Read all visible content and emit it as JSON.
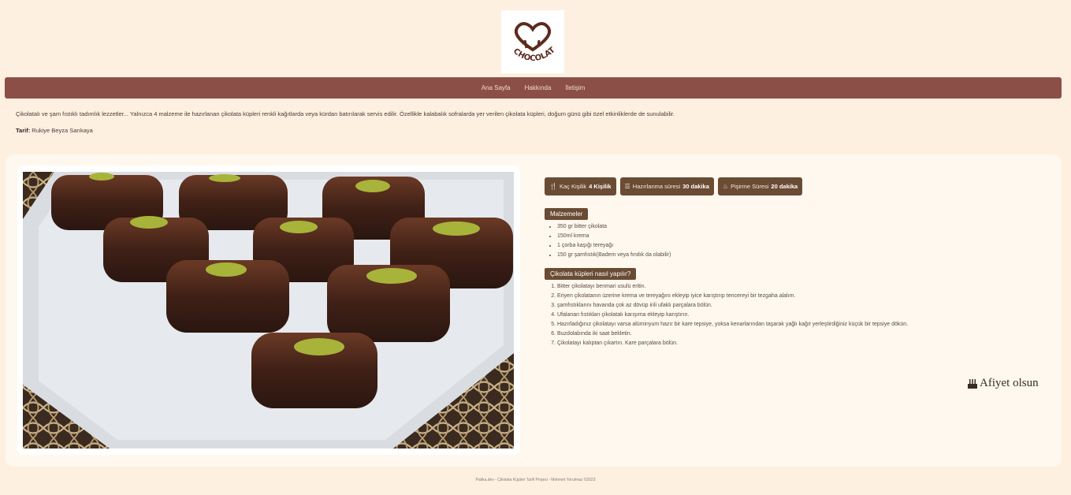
{
  "logo": {
    "text": "CHOCOLATE",
    "icon": "heart-icon"
  },
  "nav": {
    "items": [
      "Ana Sayfa",
      "Hakkında",
      "İletişim"
    ]
  },
  "intro": "Çikolatalı ve şam fıstıklı tadımlık lezzetler... Yalnızca 4 malzeme ile hazırlanan çikolata küpleri renkli kağıtlarda veya kürdan batırılarak servis edilir. Özellikle kalabalık sofralarda yer verilen çikolata küpleri, doğum günü gibi özel etkinliklerde de sunulabilir.",
  "author": {
    "label": "Tarif:",
    "name": "Rukiye Beyza Sarıkaya"
  },
  "badges": [
    {
      "icon": "utensils-icon",
      "label": "Kaç Kişilik",
      "value": "4 Kişilik"
    },
    {
      "icon": "layers-icon",
      "label": "Hazırlanma süresi",
      "value": "30 dakika"
    },
    {
      "icon": "cake-icon",
      "label": "Pişirme Süresi",
      "value": "20 dakika"
    }
  ],
  "ingredients": {
    "title": "Malzemeler",
    "items": [
      "350 gr bitter çikolata",
      "150ml krema",
      "1 çorba kaşığı tereyağı",
      "150 gr şamfıstık(Badem veya fındık da olabilir)"
    ]
  },
  "steps": {
    "title": "Çikolata küpleri nasıl yapılır?",
    "items": [
      "Bitter çikolatayı benmari usulü eritin.",
      "Eriyen çikolatanın üzerine krema ve tereyağını ekleyip iyice karıştırıp tencereyi bir tezgaha alalım.",
      "şamfıstıklarını havanda çok az dövüp irili ufaklı parçalara bölün.",
      "Ufalanan fıstıkları çikolatalı karışıma ekleyip karıştırın.",
      "Hazırladığınız çikolatayı varsa alüminyum hazır bir kare tepsiye, yoksa kenarlarından taşarak yağlı kağıt yerleştirdiğiniz küçük bir tepsiye dökün.",
      "Buzdolabında iki saat bekletin.",
      "Çikolatayı kalıptan çıkartın. Kare parçalara bölün."
    ]
  },
  "closing": {
    "icon": "birthday-cake-icon",
    "text": "Afiyet olsun"
  },
  "footer": "Patika.dev - Çikolata Küpleri Tarifi Projesi - Mehmet Yorulmaz ©2023"
}
